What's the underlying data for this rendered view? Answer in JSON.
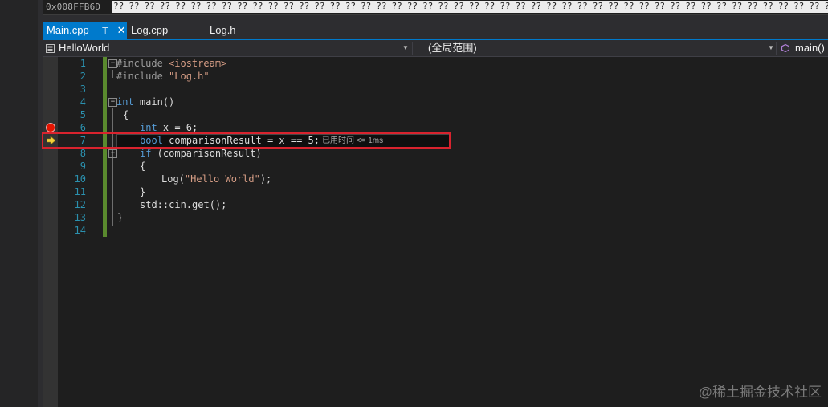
{
  "memory": {
    "address": "0x008FFB6D",
    "bytes": [
      "??",
      "??",
      "??",
      "??",
      "??",
      "??",
      "??",
      "??",
      "??",
      "??",
      "??",
      "??",
      "??",
      "??",
      "??",
      "??",
      "??",
      "??",
      "??",
      "??",
      "??",
      "??",
      "??",
      "??",
      "??",
      "??",
      "??",
      "??",
      "??",
      "??",
      "??",
      "??",
      "??",
      "??",
      "??",
      "??",
      "??",
      "??",
      "??",
      "??",
      "??",
      "??",
      "??",
      "??",
      "??",
      "??",
      "??",
      "??",
      "??"
    ]
  },
  "tabs": [
    {
      "label": "Main.cpp",
      "active": true,
      "pin": "⊤",
      "close": "✕"
    },
    {
      "label": "Log.cpp",
      "active": false
    },
    {
      "label": "Log.h",
      "active": false
    }
  ],
  "navbar": {
    "project": "HelloWorld",
    "scope": "(全局范围)",
    "member": "main()"
  },
  "editor": {
    "lines": [
      {
        "n": "1"
      },
      {
        "n": "2"
      },
      {
        "n": "3"
      },
      {
        "n": "4"
      },
      {
        "n": "5"
      },
      {
        "n": "6"
      },
      {
        "n": "7"
      },
      {
        "n": "8"
      },
      {
        "n": "9"
      },
      {
        "n": "10"
      },
      {
        "n": "11"
      },
      {
        "n": "12"
      },
      {
        "n": "13"
      },
      {
        "n": "14"
      }
    ],
    "code": {
      "l1_pp": "#include",
      "l1_rest": " <iostream>",
      "l2_pp": "#include",
      "l2_str": " \"Log.h\"",
      "l4_kw": "int",
      "l4_rest": " main()",
      "l5": "{",
      "l6_kw": "int",
      "l6_rest": " x = 6;",
      "l7_kw": "bool",
      "l7_rest": " comparisonResult = x == 5;",
      "l8_kw": "if",
      "l8_rest": " (comparisonResult)",
      "l9": "{",
      "l10_fn": "Log(",
      "l10_str": "\"Hello World\"",
      "l10_end": ");",
      "l11": "}",
      "l12": "std::cin.get();",
      "l13": "}"
    },
    "perf_tip": "已用时间 <= 1ms",
    "fold_symbol": "⊟"
  },
  "colors": {
    "accent": "#007acc",
    "breakpoint": "#e51400",
    "highlight_box": "#d9232e",
    "keyword": "#569cd6",
    "string": "#d69d85",
    "line_number": "#2b91af"
  },
  "watermark": "@稀土掘金技术社区"
}
